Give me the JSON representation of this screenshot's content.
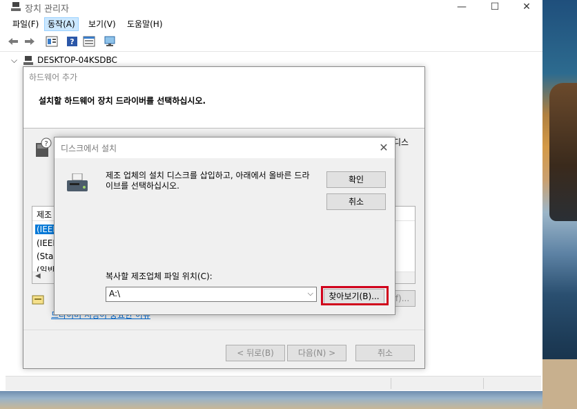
{
  "window": {
    "title": "장치 관리자",
    "minimize_glyph": "—",
    "maximize_glyph": "☐",
    "close_glyph": "✕"
  },
  "menu": {
    "items": [
      "파일(F)",
      "동작(A)",
      "보기(V)",
      "도움말(H)"
    ],
    "active_index": 1
  },
  "toolbar": {
    "icons": [
      "back-icon",
      "forward-icon",
      "properties-icon",
      "help-icon",
      "view-icon",
      "monitor-icon"
    ]
  },
  "tree": {
    "expand_glyph": "⌵",
    "root_label": "DESKTOP-04KSDBC"
  },
  "wizard": {
    "title": "하드웨어 추가",
    "instruction": "설치할 하드웨어 장치 드라이버를 선택하십시오.",
    "side_text": "디스",
    "list_header": "제조",
    "list_rows": [
      "(IEEE",
      "(IEEE",
      "(Stan",
      "(일반"
    ],
    "selected_row": 0,
    "link_text": "드라이버 서명이 중요한 이유",
    "back_label": "< 뒤로(B)",
    "next_label": "다음(N) >",
    "cancel_label": "취소",
    "hidden_button_label": "f)..."
  },
  "dialog": {
    "title": "디스크에서 설치",
    "close_glyph": "✕",
    "message": "제조 업체의 설치 디스크를 삽입하고, 아래에서 올바른 드라이브를 선택하십시오.",
    "ok_label": "확인",
    "cancel_label": "취소",
    "path_label": "복사할 제조업체 파일 위치(C):",
    "path_value": "A:\\",
    "browse_label": "찾아보기(B)...",
    "highlight_color": "#d0021b"
  }
}
